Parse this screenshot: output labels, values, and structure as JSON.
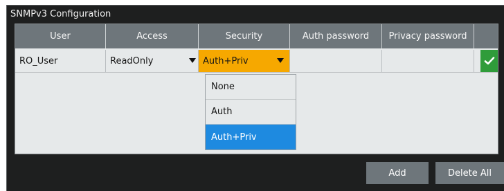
{
  "dialog": {
    "title": "SNMPv3 Configuration"
  },
  "table": {
    "columns": [
      "User",
      "Access",
      "Security",
      "Auth password",
      "Privacy password"
    ],
    "rows": [
      {
        "user": "RO_User",
        "access": "ReadOnly",
        "security": "Auth+Priv",
        "auth_password": "",
        "privacy_password": ""
      }
    ]
  },
  "security_dropdown": {
    "options": [
      "None",
      "Auth",
      "Auth+Priv"
    ],
    "selected": "Auth+Priv"
  },
  "buttons": {
    "add": "Add",
    "delete_all": "Delete All"
  },
  "colors": {
    "security_cell_bg": "#f6a800",
    "selected_option_bg": "#1e8ae0",
    "confirm_bg": "#2f9c3a"
  }
}
